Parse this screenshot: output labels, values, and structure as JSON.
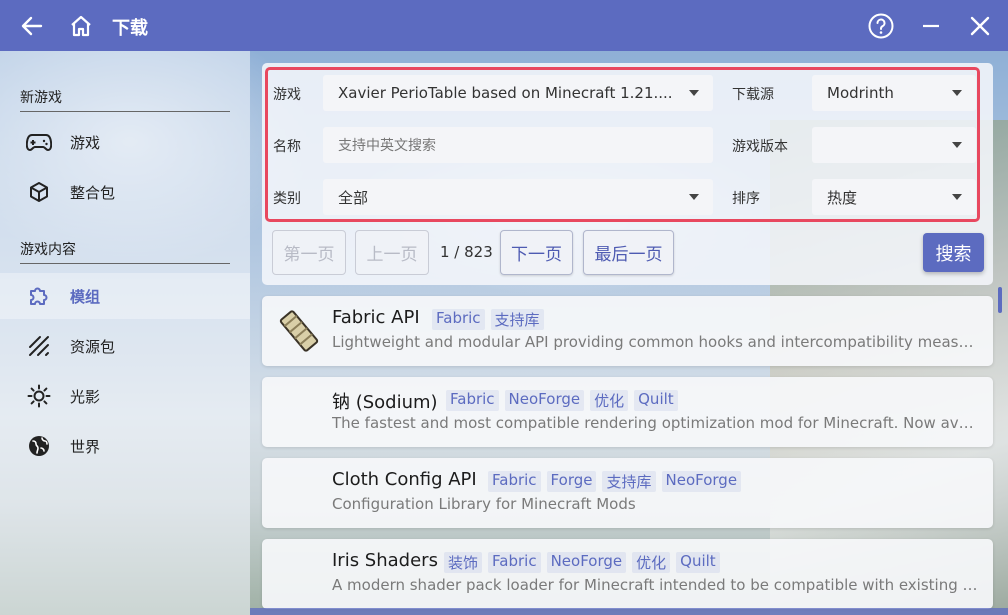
{
  "titlebar": {
    "title": "下载",
    "back_icon": "back-arrow-icon",
    "home_icon": "home-icon",
    "help_icon": "help-icon",
    "minimize_icon": "minimize-icon",
    "close_icon": "close-icon"
  },
  "sidebar": {
    "section_new_game": "新游戏",
    "section_game_content": "游戏内容",
    "items": [
      {
        "label": "游戏",
        "icon": "gamepad-icon"
      },
      {
        "label": "整合包",
        "icon": "package-icon"
      },
      {
        "label": "模组",
        "icon": "puzzle-icon",
        "active": true
      },
      {
        "label": "资源包",
        "icon": "texture-icon"
      },
      {
        "label": "光影",
        "icon": "sun-icon"
      },
      {
        "label": "世界",
        "icon": "globe-icon"
      }
    ]
  },
  "search": {
    "game_label": "游戏",
    "game_value": "Xavier PerioTable based on Minecraft 1.21....",
    "source_label": "下载源",
    "source_value": "Modrinth",
    "name_label": "名称",
    "name_placeholder": "支持中英文搜索",
    "version_label": "游戏版本",
    "version_value": "",
    "category_label": "类别",
    "category_value": "全部",
    "sort_label": "排序",
    "sort_value": "热度"
  },
  "pagination": {
    "first": "第一页",
    "prev": "上一页",
    "page_info": "1 / 823",
    "next": "下一页",
    "last": "最后一页",
    "search": "搜索"
  },
  "results": [
    {
      "name": "Fabric API",
      "tags": [
        "Fabric",
        "支持库"
      ],
      "description": "Lightweight and modular API providing common hooks and intercompatibility measures utilized by mods using the Fabric toolchain."
    },
    {
      "name": "钠 (Sodium)",
      "tags": [
        "Fabric",
        "NeoForge",
        "优化",
        "Quilt"
      ],
      "description": "The fastest and most compatible rendering optimization mod for Minecraft. Now available for both NeoForge and Fabric!"
    },
    {
      "name": "Cloth Config API",
      "tags": [
        "Fabric",
        "Forge",
        "支持库",
        "NeoForge"
      ],
      "description": "Configuration Library for Minecraft Mods"
    },
    {
      "name": "Iris Shaders",
      "tags": [
        "装饰",
        "Fabric",
        "NeoForge",
        "优化",
        "Quilt"
      ],
      "description": "A modern shader pack loader for Minecraft intended to be compatible with existing OptiFine shader packs"
    }
  ],
  "colors": {
    "accent": "#5c6bc0",
    "highlight_frame": "#e8485f"
  }
}
